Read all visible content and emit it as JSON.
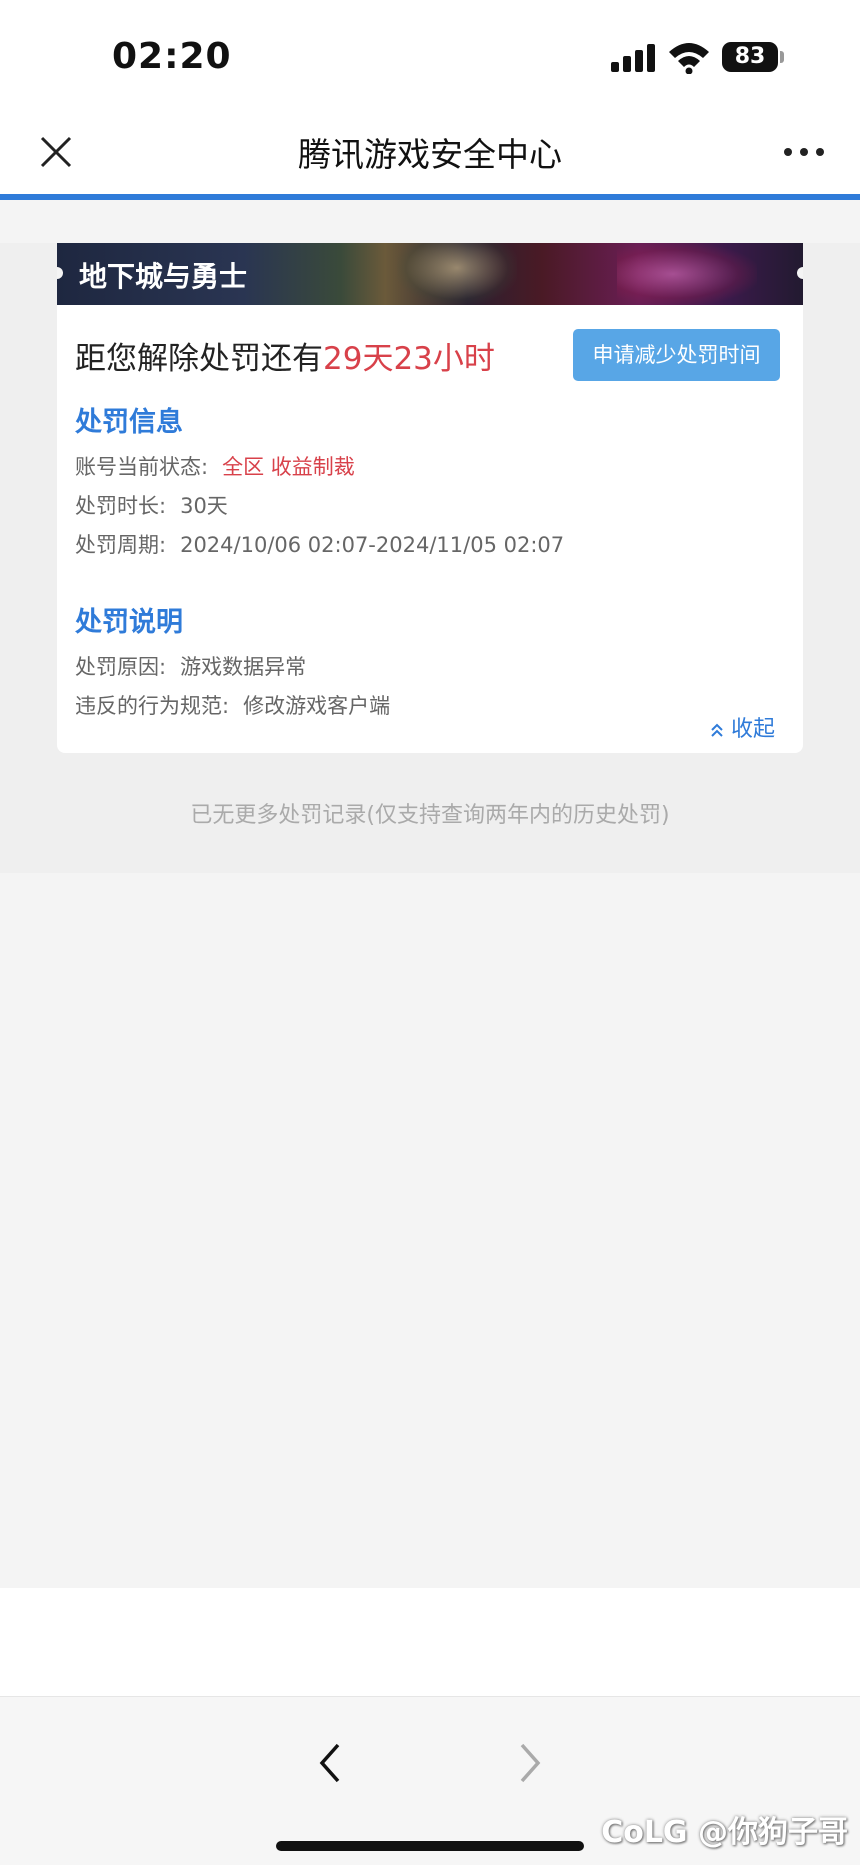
{
  "status_bar": {
    "time": "02:20",
    "battery": "83"
  },
  "nav": {
    "title": "腾讯游戏安全中心"
  },
  "card": {
    "game_name": "地下城与勇士",
    "countdown_prefix": "距您解除处罚还有",
    "countdown_value": "29天23小时",
    "apply_button": "申请减少处罚时间",
    "penalty_info": {
      "title": "处罚信息",
      "status_label": "账号当前状态:",
      "status_value": "全区 收益制裁",
      "duration_label": "处罚时长:",
      "duration_value": "30天",
      "period_label": "处罚周期:",
      "period_value": "2024/10/06 02:07-2024/11/05 02:07"
    },
    "penalty_desc": {
      "title": "处罚说明",
      "reason_label": "处罚原因:",
      "reason_value": "游戏数据异常",
      "violation_label": "违反的行为规范:",
      "violation_value": "修改游戏客户端"
    },
    "collapse_label": "收起"
  },
  "footer_note": "已无更多处罚记录(仅支持查询两年内的历史处罚)",
  "watermark": "CoLG @你狗子哥",
  "colors": {
    "accent_blue": "#2f7bd9",
    "button_blue": "#58a6e6",
    "alert_red": "#d8414a"
  }
}
